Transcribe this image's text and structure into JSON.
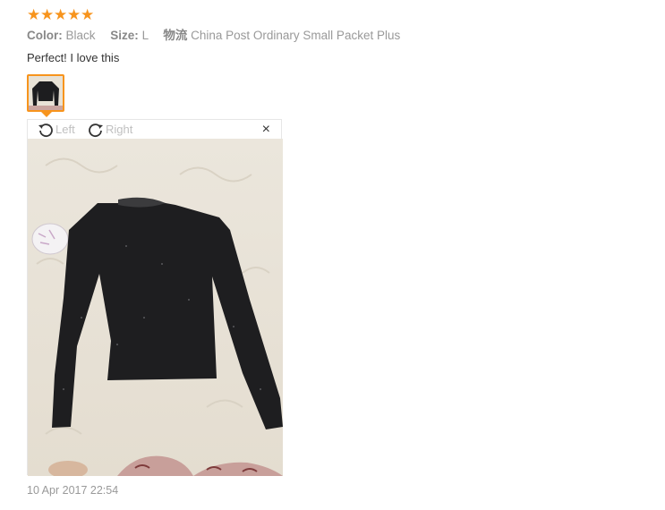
{
  "review": {
    "rating": 5,
    "color_label": "Color:",
    "color_value": "Black",
    "size_label": "Size:",
    "size_value": "L",
    "shipping_label": "物流",
    "shipping_value": "China Post Ordinary Small Packet Plus",
    "text": "Perfect! I love this",
    "date": "10 Apr 2017 22:54"
  },
  "viewer": {
    "rotate_left_label": "Left",
    "rotate_right_label": "Right",
    "close_label": "×"
  },
  "colors": {
    "star": "#f7941d",
    "thumb_border": "#f7941d",
    "muted_text": "#999999"
  },
  "icons": [
    "star-icon",
    "rotate-left-icon",
    "rotate-right-icon",
    "close-icon"
  ]
}
